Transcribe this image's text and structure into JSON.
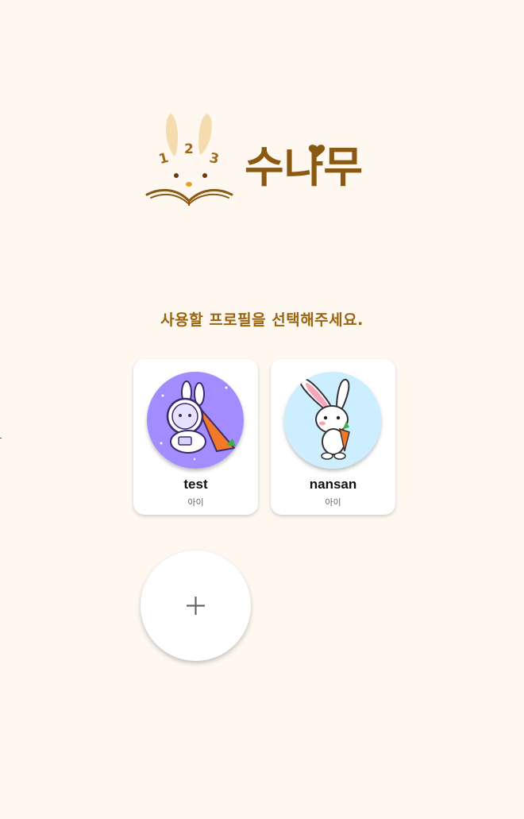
{
  "app": {
    "logo_text": "수나무",
    "logo_numbers": [
      "1",
      "2",
      "3"
    ]
  },
  "prompt": "사용할 프로필을 선택해주세요.",
  "profiles": [
    {
      "name": "test",
      "role": "아이",
      "avatar_icon": "astronaut-rabbit-icon",
      "avatar_bg": "#a38cff"
    },
    {
      "name": "nansan",
      "role": "아이",
      "avatar_icon": "rabbit-carrot-icon",
      "avatar_bg": "#cdeefe"
    }
  ],
  "add_profile_icon": "plus-icon",
  "colors": {
    "background": "#fef8f1",
    "brand_brown": "#9a6410",
    "card": "#ffffff"
  }
}
